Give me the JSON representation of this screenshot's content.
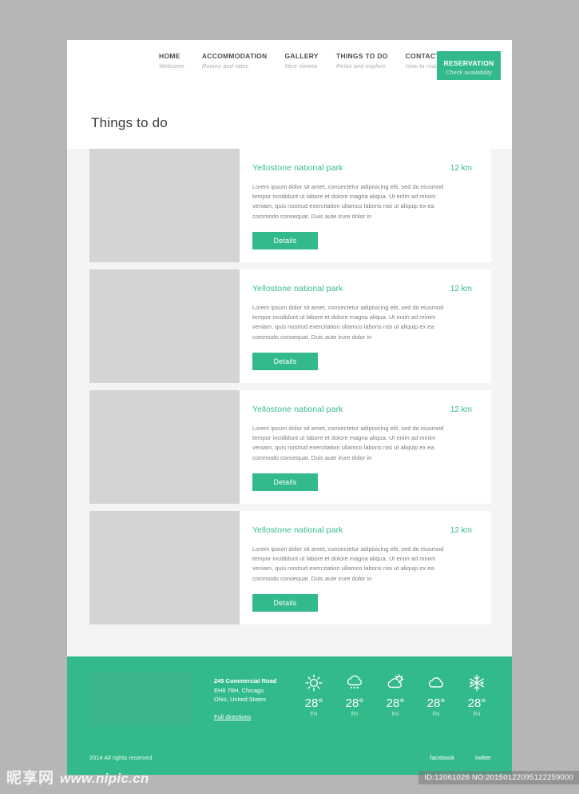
{
  "nav": {
    "items": [
      {
        "title": "HOME",
        "sub": "Welcome"
      },
      {
        "title": "ACCOMMODATION",
        "sub": "Rooms and rates"
      },
      {
        "title": "GALLERY",
        "sub": "Nice viewes"
      },
      {
        "title": "THINGS TO DO",
        "sub": "Relax and explore"
      },
      {
        "title": "CONTACT",
        "sub": "How to reach us"
      }
    ],
    "reservation": {
      "title": "RESERVATION",
      "sub": "Check availability"
    }
  },
  "main": {
    "page_title": "Things to do",
    "cards": [
      {
        "title": "Yellostone national park",
        "distance": "12 km",
        "text": "Lorem ipsum dolor sit amet, consectetur adipisicing elit, sed do eiusmod tempor incididunt ut labore et dolore magna aliqua. Ut enim ad minim veniam, quis nostrud exercitation ullamco laboris nisi ut aliquip ex ea commodo consequat. Duis aute irure dolor in",
        "button": "Details"
      },
      {
        "title": "Yellostone national park",
        "distance": "12 km",
        "text": "Lorem ipsum dolor sit amet, consectetur adipisicing elit, sed do eiusmod tempor incididunt ut labore et dolore magna aliqua. Ut enim ad minim veniam, quis nostrud exercitation ullamco laboris nisi ut aliquip ex ea commodo consequat. Duis aute irure dolor in",
        "button": "Details"
      },
      {
        "title": "Yellostone national park",
        "distance": "12 km",
        "text": "Lorem ipsum dolor sit amet, consectetur adipisicing elit, sed do eiusmod tempor incididunt ut labore et dolore magna aliqua. Ut enim ad minim veniam, quis nostrud exercitation ullamco laboris nisi ut aliquip ex ea commodo consequat. Duis aute irure dolor in",
        "button": "Details"
      },
      {
        "title": "Yellostone national park",
        "distance": "12 km",
        "text": "Lorem ipsum dolor sit amet, consectetur adipisicing elit, sed do eiusmod tempor incididunt ut labore et dolore magna aliqua. Ut enim ad minim veniam, quis nostrud exercitation ullamco laboris nisi ut aliquip ex ea commodo consequat. Duis aute irure dolor in",
        "button": "Details"
      }
    ]
  },
  "footer": {
    "address": {
      "line1": "245 Commercial Road",
      "line2": "EH6 78H, Chicago",
      "line3": "Ohio, United States",
      "link": "Full directions"
    },
    "weather": [
      {
        "icon": "sun-icon",
        "temp": "28°",
        "day": "Fri"
      },
      {
        "icon": "rain-cloud-icon",
        "temp": "28°",
        "day": "Fri"
      },
      {
        "icon": "sun-behind-cloud-icon",
        "temp": "28°",
        "day": "Fri"
      },
      {
        "icon": "cloud-icon",
        "temp": "28°",
        "day": "Fri"
      },
      {
        "icon": "snowflake-icon",
        "temp": "28°",
        "day": "Fri"
      }
    ],
    "copyright": "2014 All rights reserved",
    "social": [
      {
        "label": "facebook"
      },
      {
        "label": "twitter"
      }
    ]
  },
  "watermark": {
    "logo": "昵享网",
    "url": "www.nipic.cn",
    "id": "ID:12061026 NO:20150122095122259000"
  },
  "colors": {
    "accent": "#33ba8a",
    "page_bg": "#b6b6b6",
    "card_bg": "#ffffff",
    "thumb": "#d4d4d4",
    "section_bg": "#f4f4f4"
  }
}
